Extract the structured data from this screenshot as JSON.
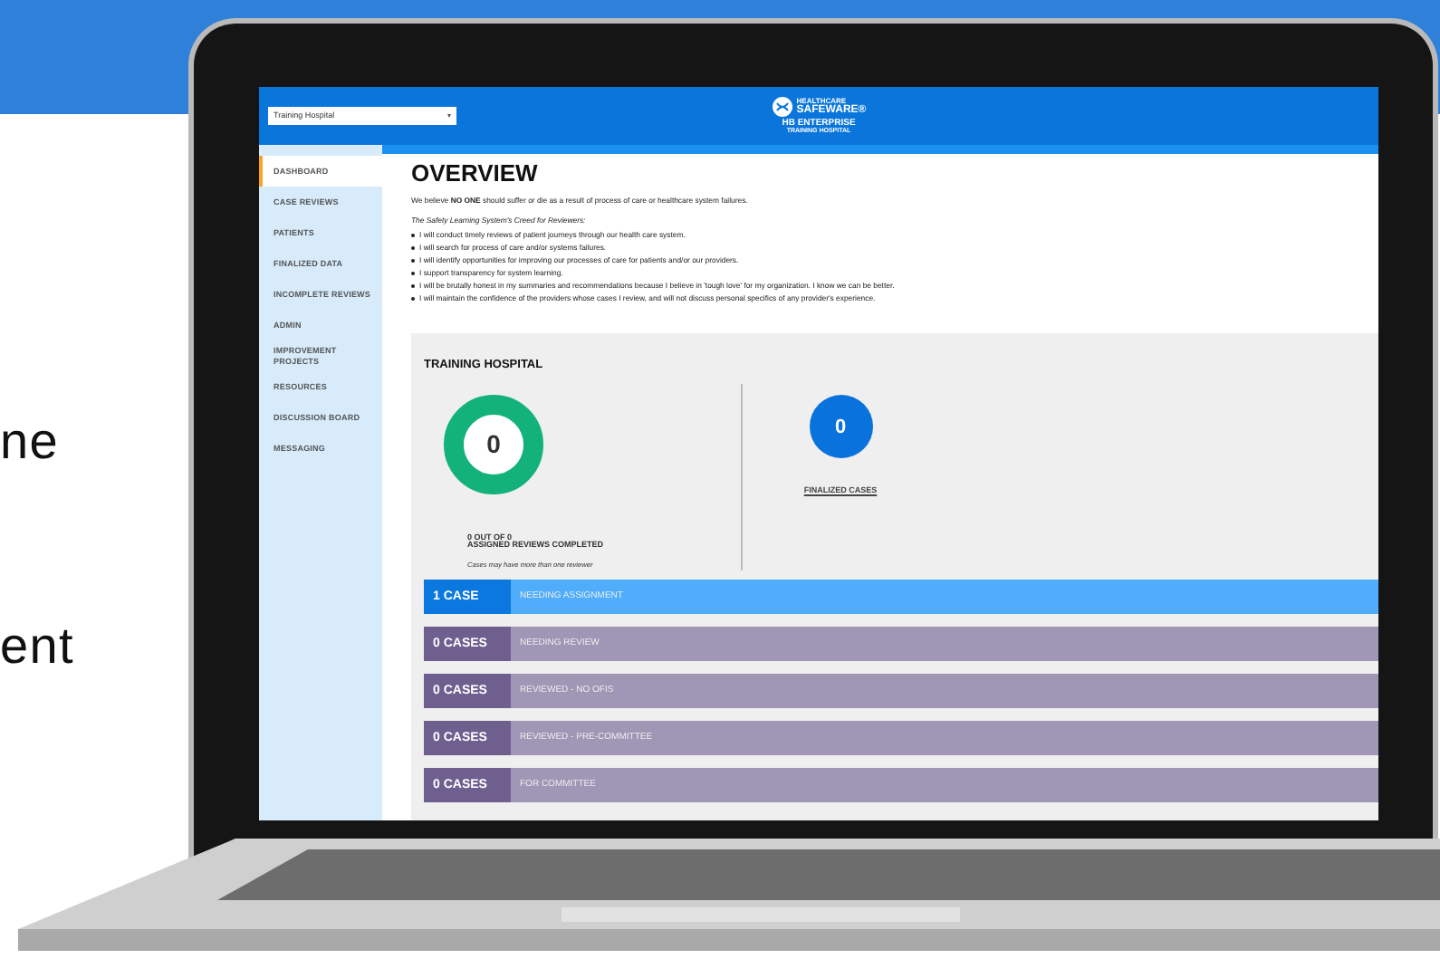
{
  "side_text": [
    "ne",
    "ent"
  ],
  "app": {
    "hospital_select": {
      "value": "Training Hospital"
    },
    "logo": {
      "line_1": "HEALTHCARE",
      "line_2": "SAFEWARE®",
      "title": "HB ENTERPRISE",
      "subtitle": "TRAINING HOSPITAL"
    },
    "sidebar": {
      "items": [
        {
          "label": "DASHBOARD",
          "selected": true
        },
        {
          "label": "CASE REVIEWS",
          "selected": false
        },
        {
          "label": "PATIENTS",
          "selected": false
        },
        {
          "label": "FINALIZED DATA",
          "selected": false
        },
        {
          "label": "INCOMPLETE REVIEWS",
          "selected": false
        },
        {
          "label": "ADMIN",
          "selected": false
        },
        {
          "label": "IMPROVEMENT PROJECTS",
          "selected": false
        },
        {
          "label": "RESOURCES",
          "selected": false
        },
        {
          "label": "DISCUSSION BOARD",
          "selected": false
        },
        {
          "label": "MESSAGING",
          "selected": false
        }
      ]
    },
    "heading": "OVERVIEW",
    "intro": "We believe **NO ONE** should suffer or die as a result of process of care or healthcare system failures.",
    "creed_title": "The Safety Learning System's Creed for Reviewers:",
    "creed": [
      "I will conduct timely reviews of patient journeys through our health care system.",
      "I will search for process of care and/or systems failures.",
      "I will identify opportunities for improving our processes of care for patients and/or our providers.",
      "I support transparency for system learning.",
      "I will be brutally honest in my summaries and recommendations because I believe in 'tough love' for my organization. I know we can be better.",
      "I will maintain the confidence of the providers whose cases I review, and will not discuss personal specifics of any provider's experience."
    ],
    "panel": {
      "title": "TRAINING HOSPITAL",
      "ring_value": "0",
      "completed_line_1": "0 OUT OF 0",
      "completed_line_2": "ASSIGNED REVIEWS COMPLETED",
      "note": "Cases may have more than one reviewer",
      "finalized_value": "0",
      "finalized_link": "FINALIZED CASES"
    },
    "case_rows": [
      {
        "count": "1 CASE",
        "label": "NEEDING ASSIGNMENT",
        "kind": "active"
      },
      {
        "count": "0 CASES",
        "label": "NEEDING REVIEW",
        "kind": "muted"
      },
      {
        "count": "0 CASES",
        "label": "REVIEWED - NO OFIS",
        "kind": "muted"
      },
      {
        "count": "0 CASES",
        "label": "REVIEWED - PRE-COMMITTEE",
        "kind": "muted"
      },
      {
        "count": "0 CASES",
        "label": "FOR COMMITTEE",
        "kind": "muted"
      }
    ]
  }
}
